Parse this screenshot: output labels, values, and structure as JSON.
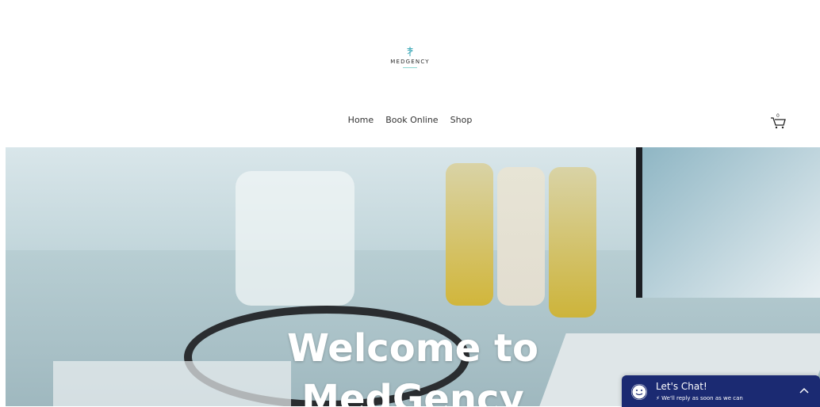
{
  "brand": {
    "name": "MEDGENCY",
    "icon": "caduceus-icon",
    "accent": "#4fb6c3"
  },
  "nav": {
    "items": [
      "Home",
      "Book Online",
      "Shop"
    ]
  },
  "cart": {
    "count": "0",
    "icon": "cart-icon"
  },
  "hero": {
    "title_line1": "Welcome to",
    "title_line2": "MedGency"
  },
  "chat": {
    "title": "Let's Chat!",
    "subtitle": "We'll reply as soon as we can",
    "bg": "#1b2a72"
  }
}
